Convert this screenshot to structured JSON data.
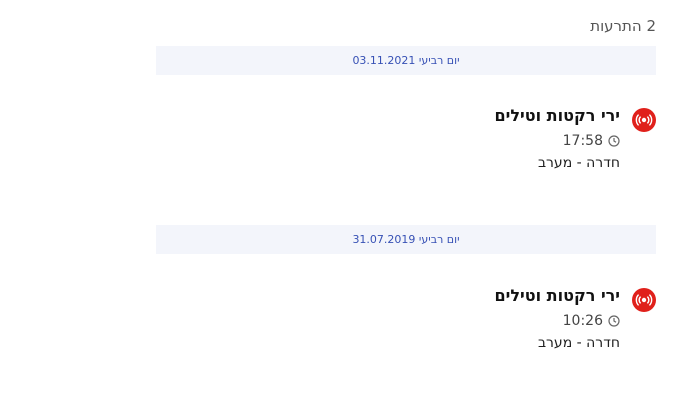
{
  "header": {
    "count_text": "2 התרעות"
  },
  "groups": [
    {
      "date_label": "יום רביעי 03.11.2021",
      "alert": {
        "icon": "siren-icon",
        "title": "ירי רקטות וטילים",
        "time": "17:58",
        "area": "חדרה - מערב"
      }
    },
    {
      "date_label": "יום רביעי 31.07.2019",
      "alert": {
        "icon": "siren-icon",
        "title": "ירי רקטות וטילים",
        "time": "10:26",
        "area": "חדרה - מערב"
      }
    }
  ],
  "colors": {
    "alert_red": "#e0201b",
    "date_text": "#3751b5",
    "date_bg": "#f3f5fb"
  }
}
